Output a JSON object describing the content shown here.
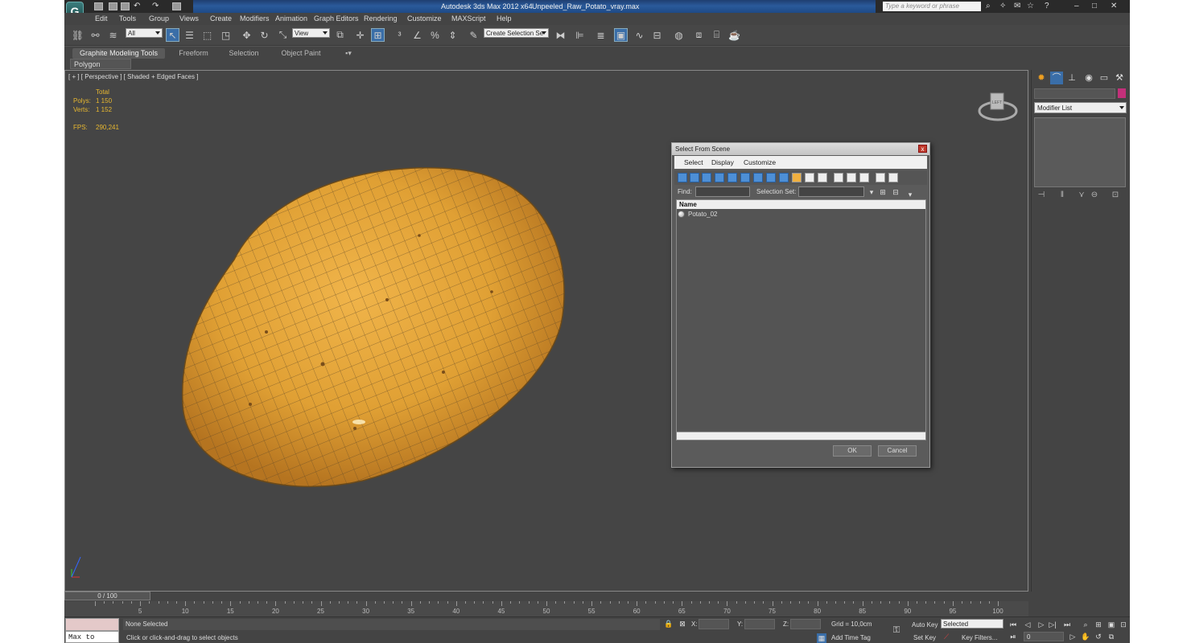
{
  "window": {
    "app_title": "Autodesk 3ds Max  2012 x64",
    "file_title": "Unpeeled_Raw_Potato_vray.max",
    "logo_letter": "G",
    "search_placeholder": "Type a keyword or phrase"
  },
  "menu": [
    "Edit",
    "Tools",
    "Group",
    "Views",
    "Create",
    "Modifiers",
    "Animation",
    "Graph Editors",
    "Rendering",
    "Customize",
    "MAXScript",
    "Help"
  ],
  "toolbar": {
    "filter": "All",
    "ref_coord": "View",
    "named_sel": "Create Selection Se"
  },
  "ribbon": {
    "tabs": [
      "Graphite Modeling Tools",
      "Freeform",
      "Selection",
      "Object Paint"
    ],
    "panel": "Polygon Modeling"
  },
  "viewport": {
    "label": "[ + ] [ Perspective ] [ Shaded + Edged Faces ]",
    "stats": {
      "total_label": "Total",
      "polys_label": "Polys:",
      "polys": "1 150",
      "verts_label": "Verts:",
      "verts": "1 152",
      "fps_label": "FPS:",
      "fps": "290,241"
    },
    "viewcube_face": "LEFT"
  },
  "command_panel": {
    "modifier_list": "Modifier List",
    "object_color": "#c2307a"
  },
  "timeline": {
    "slider": "0 / 100",
    "ticks": [
      "5",
      "10",
      "15",
      "20",
      "25",
      "30",
      "35",
      "40",
      "45",
      "50",
      "55",
      "60",
      "65",
      "70",
      "75",
      "80",
      "85",
      "90",
      "95",
      "100"
    ]
  },
  "status": {
    "script_listener": "Max to Physc",
    "selection": "None Selected",
    "prompt": "Click or click-and-drag to select objects",
    "x_label": "X:",
    "y_label": "Y:",
    "z_label": "Z:",
    "grid": "Grid = 10,0cm",
    "add_time_tag": "Add Time Tag",
    "auto_key": "Auto Key",
    "set_key": "Set Key",
    "key_mode": "Selected",
    "key_filters": "Key Filters...",
    "frame": "0"
  },
  "dialog": {
    "title": "Select From Scene",
    "close": "x",
    "menu": [
      "Select",
      "Display",
      "Customize"
    ],
    "find_label": "Find:",
    "selset_label": "Selection Set:",
    "column": "Name",
    "objects": [
      "Potato_02"
    ],
    "ok": "OK",
    "cancel": "Cancel"
  }
}
